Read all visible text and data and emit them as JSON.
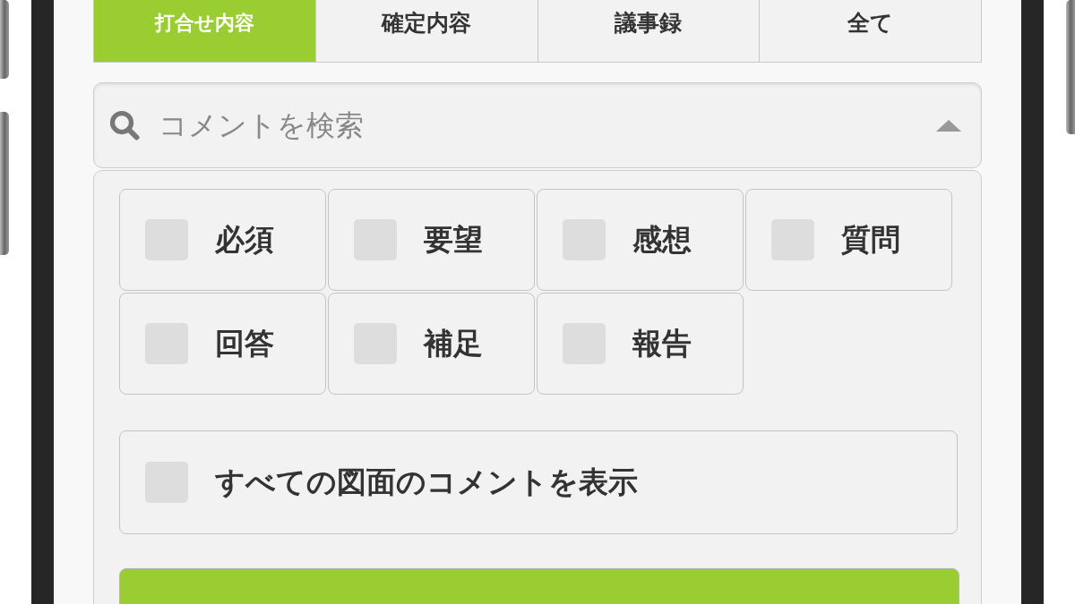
{
  "tabs": [
    {
      "label": "打合せ内容",
      "selected": true
    },
    {
      "label": "確定内容",
      "selected": false
    },
    {
      "label": "議事録",
      "selected": false
    },
    {
      "label": "全て",
      "selected": false
    }
  ],
  "search": {
    "placeholder": "コメントを検索",
    "expanded": true
  },
  "categories": [
    {
      "label": "必須",
      "checked": false
    },
    {
      "label": "要望",
      "checked": false
    },
    {
      "label": "感想",
      "checked": false
    },
    {
      "label": "質問",
      "checked": false
    },
    {
      "label": "回答",
      "checked": false
    },
    {
      "label": "補足",
      "checked": false
    },
    {
      "label": "報告",
      "checked": false
    }
  ],
  "show_all": {
    "label": "すべての図面のコメントを表示",
    "checked": false
  }
}
